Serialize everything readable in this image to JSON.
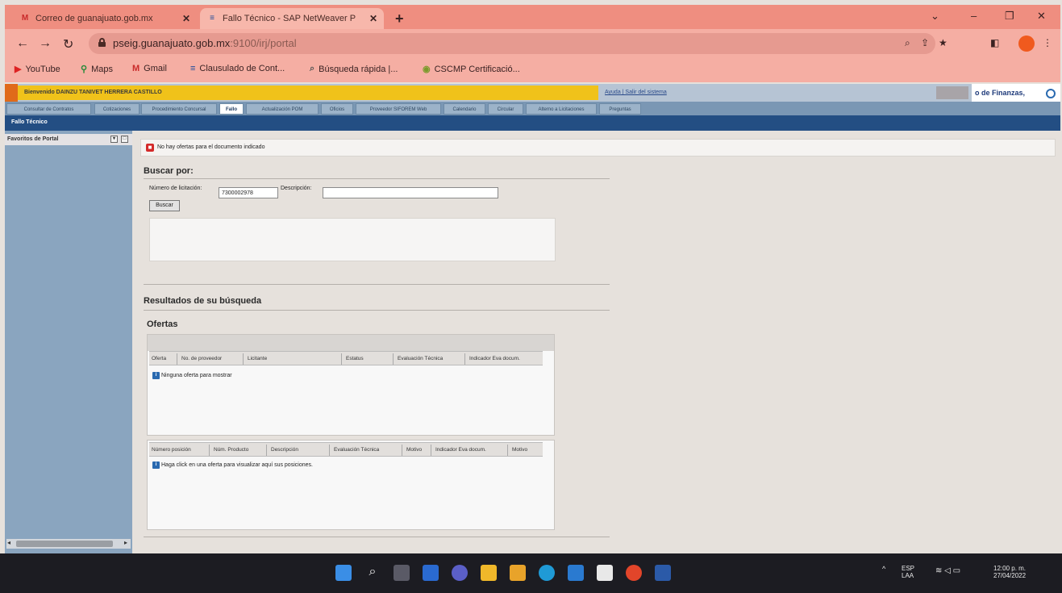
{
  "browser": {
    "tabs": [
      {
        "label": "Correo de guanajuato.gob.mx",
        "favicon": "M"
      },
      {
        "label": "Fallo Técnico - SAP NetWeaver P",
        "favicon": "≡"
      }
    ],
    "url_host": "pseig.guanajuato.gob.mx",
    "url_rest": ":9100/irj/portal",
    "bookmarks": [
      {
        "label": "YouTube",
        "icon": "youtube-icon"
      },
      {
        "label": "Maps",
        "icon": "maps-icon"
      },
      {
        "label": "Gmail",
        "icon": "gmail-icon"
      },
      {
        "label": "Clausulado de Cont...",
        "icon": "doc-icon"
      },
      {
        "label": "Búsqueda rápida |...",
        "icon": "search-icon"
      },
      {
        "label": "CSCMP Certificació...",
        "icon": "globe-icon"
      }
    ]
  },
  "portal": {
    "welcome": "Bienvenido DAINZU TANIVET HERRERA CASTILLO",
    "help_links": "Ayuda | Salir del sistema",
    "brand": "o de Finanzas,",
    "nav_tabs": [
      "Consultar de Contratos",
      "Cotizaciones",
      "Procedimiento Concursal",
      "Fallo",
      "Actualización POM",
      "Oficios",
      "Proveedor SIFOREM Web",
      "Calendario",
      "Circular",
      "Alterno a Licitaciones",
      "Preguntas"
    ],
    "selected_tab": "Fallo",
    "sub_title": "Fallo Técnico",
    "left_title": "Favoritos de Portal",
    "message": "No hay ofertas para el documento indicado",
    "search": {
      "title": "Buscar por:",
      "lot_label": "Número de licitación:",
      "lot_value": "7300002978",
      "desc_label": "Descripción:",
      "desc_value": "",
      "button": "Buscar"
    },
    "results_title": "Resultados de su búsqueda",
    "offers_title": "Ofertas",
    "offers_columns": [
      "Oferta",
      "No. de proveedor",
      "Licitante",
      "Estatus",
      "Evaluación Técnica",
      "Indicador Eva docum."
    ],
    "offers_empty": "Ninguna oferta para mostrar",
    "positions_columns": [
      "Número posición",
      "Núm. Producto",
      "Descripción",
      "Evaluación Técnica",
      "Motivo",
      "Indicador Eva docum.",
      "Motivo"
    ],
    "positions_empty": "Haga click en una oferta para visualizar aquí sus posiciones."
  },
  "taskbar": {
    "lang": "ESP",
    "lang2": "LAA",
    "time": "12:00 p. m.",
    "date": "27/04/2022"
  }
}
